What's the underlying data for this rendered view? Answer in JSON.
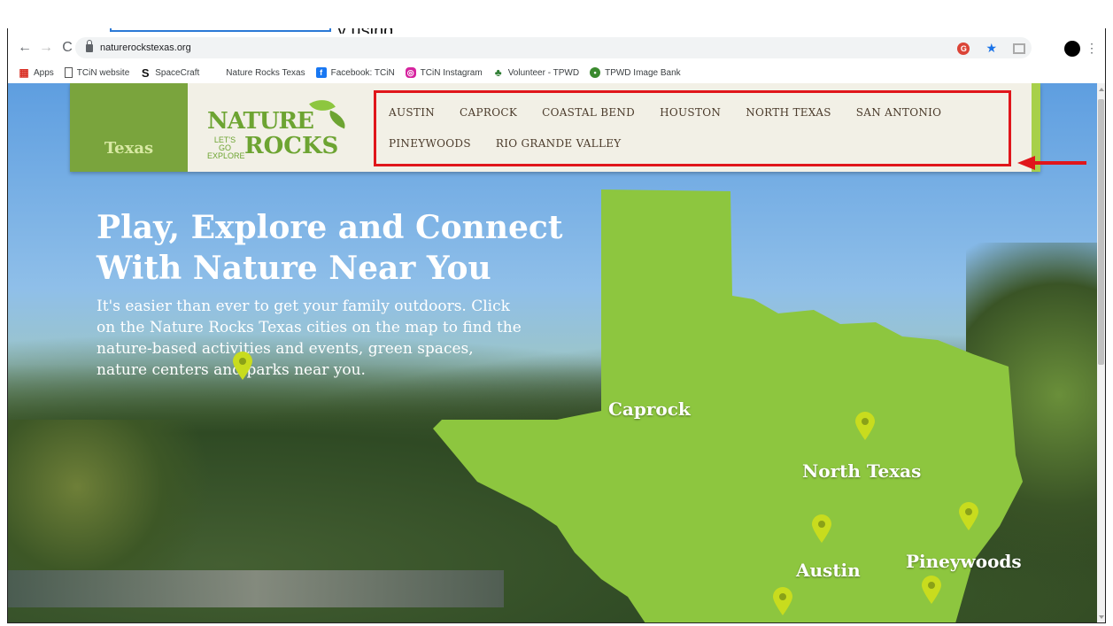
{
  "top_caption": "y using",
  "browser": {
    "url": "naturerockstexas.org",
    "bookmarks": [
      {
        "label": "Apps",
        "icon": "apps-grid-icon"
      },
      {
        "label": "TCiN website",
        "icon": "document-icon"
      },
      {
        "label": "SpaceCraft",
        "icon": "spacecraft-s-icon"
      },
      {
        "label": "Nature Rocks Texas",
        "icon": ""
      },
      {
        "label": "Facebook: TCiN",
        "icon": "facebook-icon"
      },
      {
        "label": "TCiN Instagram",
        "icon": "instagram-icon"
      },
      {
        "label": "Volunteer - TPWD",
        "icon": "leaf-icon"
      },
      {
        "label": "TPWD Image Bank",
        "icon": "tpwd-icon"
      }
    ]
  },
  "site": {
    "state_label": "Texas",
    "logo": {
      "word1": "NATURE",
      "small": "LET'S GO EXPLORE",
      "word2": "ROCKS"
    },
    "regions_row1": [
      "AUSTIN",
      "CAPROCK",
      "COASTAL BEND",
      "HOUSTON",
      "NORTH TEXAS",
      "SAN ANTONIO"
    ],
    "regions_row2": [
      "PINEYWOODS",
      "RIO GRANDE VALLEY"
    ],
    "hero_title_line1": "Play, Explore and Connect",
    "hero_title_line2": "With Nature Near You",
    "hero_text": "It's easier than ever to get your family outdoors. Click on the Nature Rocks Texas cities on the map to find the nature-based activities and events, green spaces, nature centers and parks near you.",
    "map_labels": {
      "caprock": "Caprock",
      "north_texas": "North Texas",
      "austin": "Austin",
      "pineywoods": "Pineywoods"
    }
  },
  "colors": {
    "highlight": "#e0161b",
    "state_tab": "#7aa43d",
    "map_green": "#8dc63f",
    "pin": "#c8dc1e"
  }
}
